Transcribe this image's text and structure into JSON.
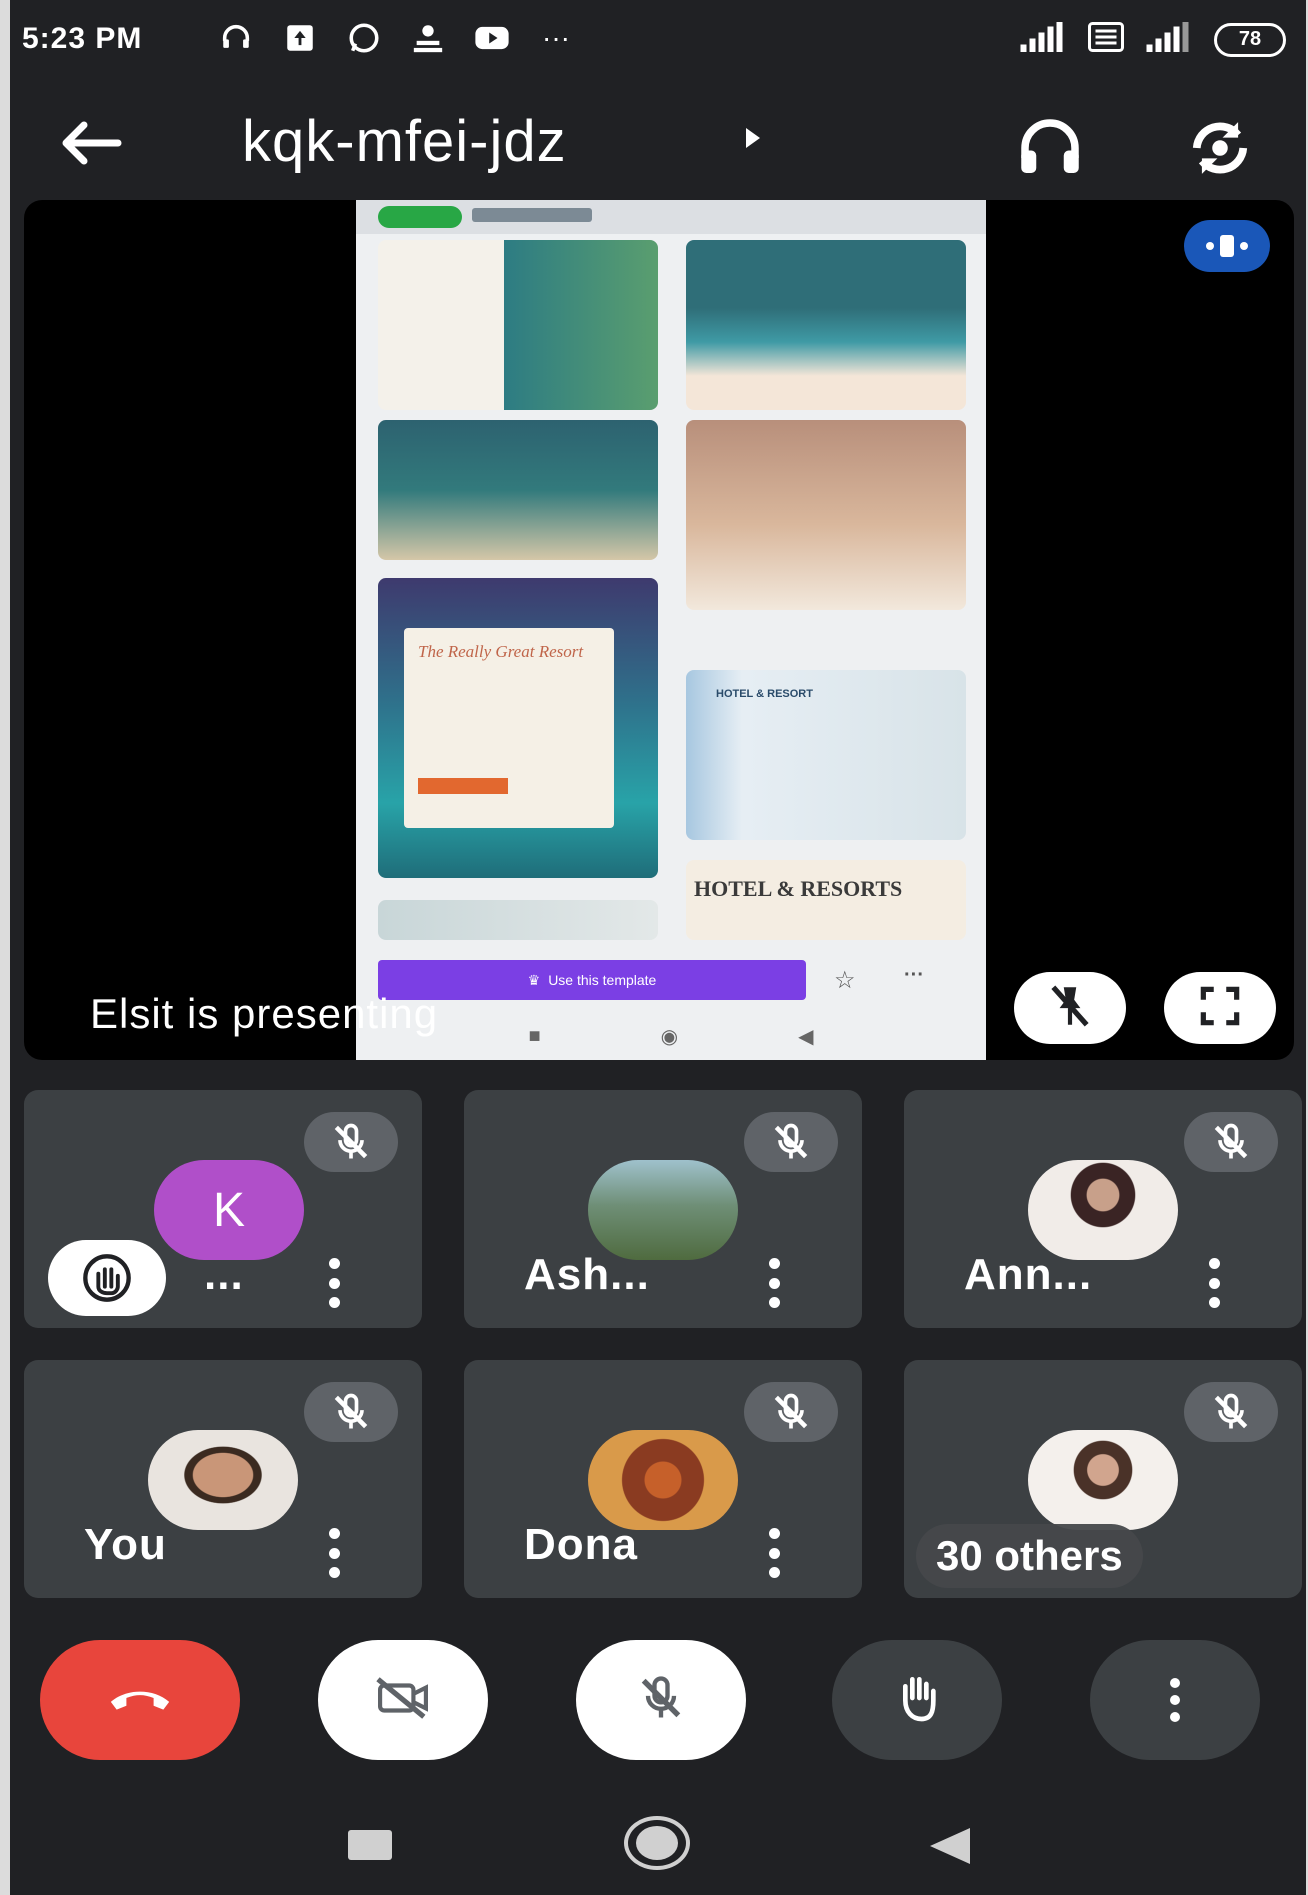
{
  "status_bar": {
    "time": "5:23 PM",
    "more": "···",
    "battery": "78",
    "left_icons": [
      "headset-icon",
      "upload-icon",
      "whatsapp-icon",
      "person-icon",
      "youtube-icon"
    ],
    "right_icons": [
      "signal-icon",
      "data-icon",
      "signal-icon",
      "battery-icon"
    ]
  },
  "app_bar": {
    "title": "kqk-mfei-jdz",
    "icons": [
      "back-arrow-icon",
      "headphones-icon",
      "switch-camera-icon"
    ]
  },
  "presentation": {
    "presenter_label": "Elsit is presenting",
    "shared_screen": {
      "thumb_5_title": "The Really Great Resort",
      "thumb_6_label": "HOTEL & RESORT",
      "thumb_7_label": "HOTEL & RESORTS",
      "use_template_label": "Use this template"
    },
    "icons": [
      "presentation-icon",
      "unpin-icon",
      "fullscreen-icon"
    ]
  },
  "participants": [
    {
      "name": "...",
      "avatar_letter": "K",
      "avatar_color": "#b04fc9",
      "muted": true,
      "hand_raised": true
    },
    {
      "name": "Ash...",
      "muted": true
    },
    {
      "name": "Ann...",
      "muted": true
    },
    {
      "name": "You",
      "muted": true
    },
    {
      "name": "Dona",
      "muted": true
    },
    {
      "name": "30 others",
      "muted": true
    }
  ],
  "controls": {
    "icons": [
      "end-call-icon",
      "camera-off-icon",
      "mic-off-icon",
      "raise-hand-icon",
      "more-options-icon"
    ],
    "end_call_color": "#e8453c"
  },
  "nav_bar": {
    "icons": [
      "recent-apps-icon",
      "home-icon",
      "back-icon"
    ]
  }
}
